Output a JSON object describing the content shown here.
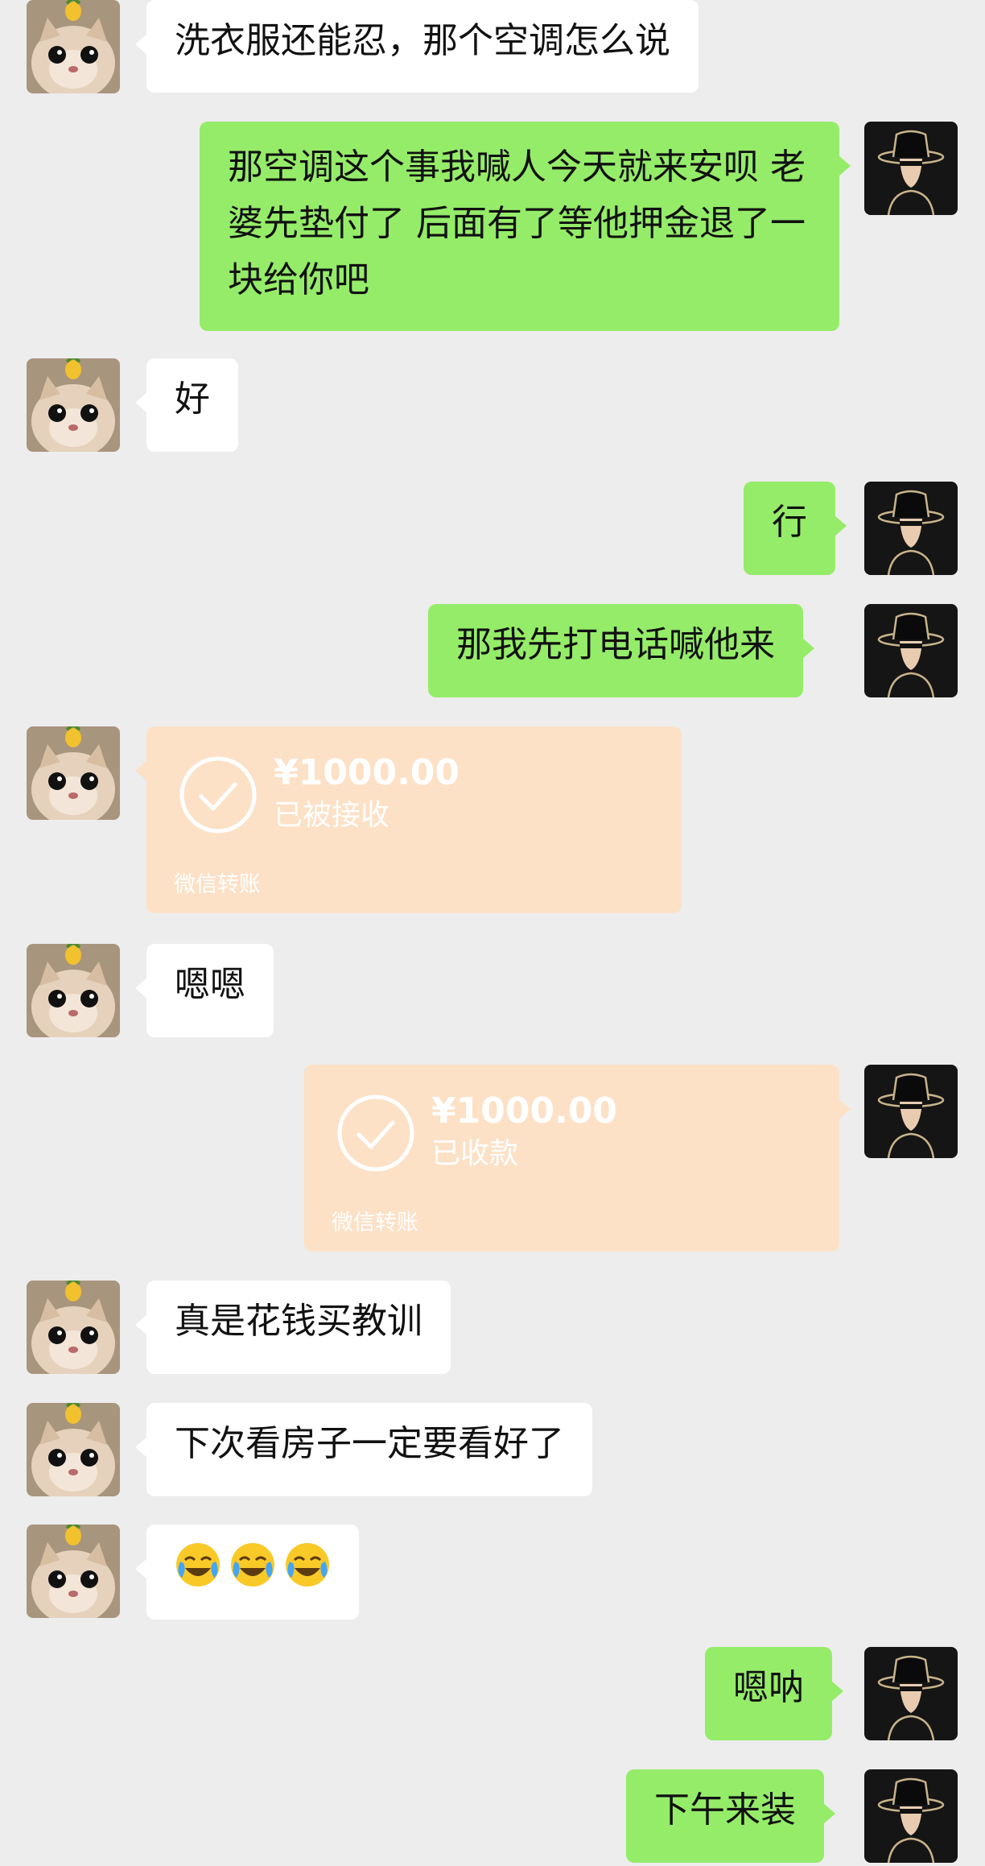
{
  "messages": [
    {
      "text": "洗衣服还能忍，那个空调怎么说"
    },
    {
      "text": "那空调这个事我喊人今天就来安呗 老婆先垫付了 后面有了等他押金退了一块给你吧"
    },
    {
      "text": "好"
    },
    {
      "text": "行"
    },
    {
      "text": "那我先打电话喊他来"
    },
    {
      "amount": "¥1000.00",
      "status": "已被接收",
      "footer": "微信转账"
    },
    {
      "text": "嗯嗯"
    },
    {
      "amount": "¥1000.00",
      "status": "已收款",
      "footer": "微信转账"
    },
    {
      "text": "真是花钱买教训"
    },
    {
      "text": "下次看房子一定要看好了"
    },
    {
      "emoji": "crying-laughing-face",
      "count": 3
    },
    {
      "text": "嗯呐"
    },
    {
      "text": "下午来装"
    }
  ],
  "colors": {
    "background": "#ededed",
    "incoming_bubble": "#ffffff",
    "outgoing_bubble": "#95ec69",
    "transfer_card": "#fde1c6"
  },
  "icons": {
    "incoming_avatar": "cat-with-pineapple-avatar",
    "outgoing_avatar": "hat-figure-avatar",
    "transfer": "check-circle-icon"
  }
}
